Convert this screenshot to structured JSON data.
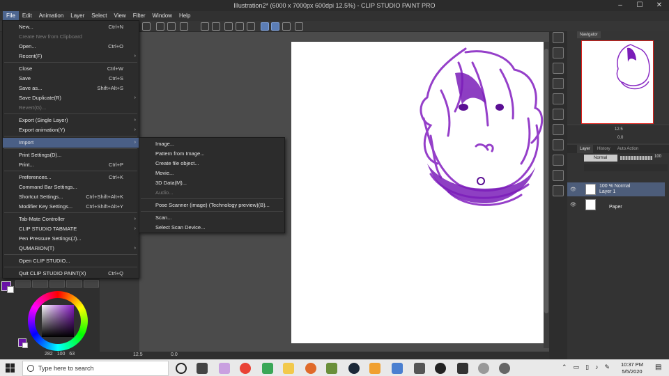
{
  "window": {
    "title": "Illustration2* (6000 x 7000px 600dpi 12.5%) - CLIP STUDIO PAINT PRO",
    "minimize": "–",
    "maximize": "☐",
    "close": "✕"
  },
  "menubar": [
    "File",
    "Edit",
    "Animation",
    "Layer",
    "Select",
    "View",
    "Filter",
    "Window",
    "Help"
  ],
  "file_menu": [
    {
      "label": "New...",
      "shortcut": "Ctrl+N",
      "enabled": true
    },
    {
      "label": "Create New from Clipboard",
      "shortcut": "",
      "enabled": false
    },
    {
      "label": "Open...",
      "shortcut": "Ctrl+O",
      "enabled": true
    },
    {
      "label": "Recent(F)",
      "shortcut": "",
      "enabled": true,
      "submenu": true
    },
    {
      "separator": true
    },
    {
      "label": "Close",
      "shortcut": "Ctrl+W",
      "enabled": true
    },
    {
      "label": "Save",
      "shortcut": "Ctrl+S",
      "enabled": true
    },
    {
      "label": "Save as...",
      "shortcut": "Shift+Alt+S",
      "enabled": true
    },
    {
      "label": "Save Duplicate(R)",
      "shortcut": "",
      "enabled": true,
      "submenu": true
    },
    {
      "label": "Revert(G)...",
      "shortcut": "",
      "enabled": false
    },
    {
      "separator": true
    },
    {
      "label": "Export (Single Layer)",
      "shortcut": "",
      "enabled": true,
      "submenu": true
    },
    {
      "label": "Export animation(Y)",
      "shortcut": "",
      "enabled": true,
      "submenu": true
    },
    {
      "separator": true
    },
    {
      "label": "Import",
      "shortcut": "",
      "enabled": true,
      "submenu": true,
      "highlighted": true
    },
    {
      "separator": true
    },
    {
      "label": "Print Settings(D)...",
      "shortcut": "",
      "enabled": true
    },
    {
      "label": "Print...",
      "shortcut": "Ctrl+P",
      "enabled": true
    },
    {
      "separator": true
    },
    {
      "label": "Preferences...",
      "shortcut": "Ctrl+K",
      "enabled": true
    },
    {
      "label": "Command Bar Settings...",
      "shortcut": "",
      "enabled": true
    },
    {
      "label": "Shortcut Settings...",
      "shortcut": "Ctrl+Shift+Alt+K",
      "enabled": true
    },
    {
      "label": "Modifier Key Settings...",
      "shortcut": "Ctrl+Shift+Alt+Y",
      "enabled": true
    },
    {
      "separator": true
    },
    {
      "label": "Tab-Mate Controller",
      "shortcut": "",
      "enabled": true,
      "submenu": true
    },
    {
      "label": "CLIP STUDIO TABMATE",
      "shortcut": "",
      "enabled": true,
      "submenu": true
    },
    {
      "label": "Pen Pressure Settings(J)...",
      "shortcut": "",
      "enabled": true
    },
    {
      "label": "QUMARION(T)",
      "shortcut": "",
      "enabled": true,
      "submenu": true
    },
    {
      "separator": true
    },
    {
      "label": "Open CLIP STUDIO...",
      "shortcut": "",
      "enabled": true
    },
    {
      "separator": true
    },
    {
      "label": "Quit CLIP STUDIO PAINT(X)",
      "shortcut": "Ctrl+Q",
      "enabled": true
    }
  ],
  "import_submenu": [
    {
      "label": "Image...",
      "enabled": true
    },
    {
      "label": "Pattern from Image...",
      "enabled": true
    },
    {
      "label": "Create file object...",
      "enabled": true
    },
    {
      "label": "Movie...",
      "enabled": true
    },
    {
      "label": "3D Data(M)...",
      "enabled": true
    },
    {
      "label": "Audio...",
      "enabled": false
    },
    {
      "separator": true
    },
    {
      "label": "Pose Scanner (image) (Technology preview)(B)...",
      "enabled": true
    },
    {
      "separator": true
    },
    {
      "label": "Scan...",
      "enabled": true
    },
    {
      "label": "Select Scan Device...",
      "enabled": true
    }
  ],
  "navigator": {
    "tab_label": "Navigator",
    "zoom": "12.5",
    "angle": "0.0"
  },
  "layer_panel": {
    "tabs": [
      "Layer",
      "History",
      "Auto Action"
    ],
    "blend_mode": "Normal",
    "opacity": "100",
    "layers": [
      {
        "mode_line": "100 % Normal",
        "name": "Layer 1",
        "selected": true
      },
      {
        "mode_line": "",
        "name": "Paper",
        "selected": false
      }
    ]
  },
  "color": {
    "main": "#6a12a8",
    "sub": "#ffffff",
    "r": "282",
    "g": "100",
    "b": "63"
  },
  "canvas_status": {
    "zoom": "12.5",
    "angle": "0.0"
  },
  "taskbar": {
    "search_placeholder": "Type here to search",
    "time": "10:37 PM",
    "date": "5/5/2020"
  }
}
